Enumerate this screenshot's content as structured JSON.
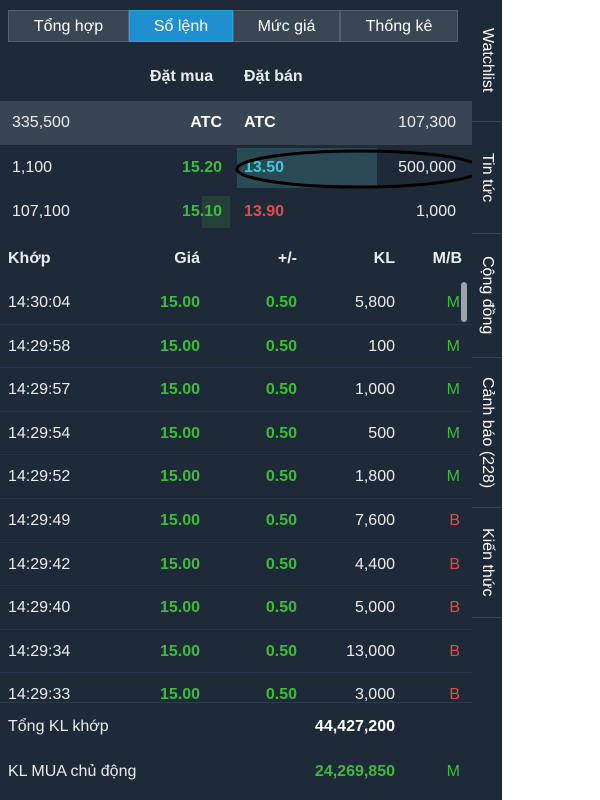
{
  "tabs": [
    {
      "label": "Tổng hợp",
      "active": false
    },
    {
      "label": "Sổ lệnh",
      "active": true
    },
    {
      "label": "Mức giá",
      "active": false
    },
    {
      "label": "Thống kê",
      "active": false
    }
  ],
  "orderbook": {
    "header_buy": "Đặt mua",
    "header_sell": "Đặt bán",
    "rows": [
      {
        "buy_vol": "335,500",
        "buy_price": "ATC",
        "sell_price": "ATC",
        "sell_vol": "107,300"
      },
      {
        "buy_vol": "1,100",
        "buy_price": "15.20",
        "sell_price": "13.50",
        "sell_vol": "500,000"
      },
      {
        "buy_vol": "107,100",
        "buy_price": "15.10",
        "sell_price": "13.90",
        "sell_vol": "1,000"
      }
    ]
  },
  "trades": {
    "headers": {
      "time": "Khớp",
      "price": "Giá",
      "change": "+/-",
      "volume": "KL",
      "side": "M/B"
    },
    "rows": [
      {
        "time": "14:30:04",
        "price": "15.00",
        "change": "0.50",
        "volume": "5,800",
        "side": "M"
      },
      {
        "time": "14:29:58",
        "price": "15.00",
        "change": "0.50",
        "volume": "100",
        "side": "M"
      },
      {
        "time": "14:29:57",
        "price": "15.00",
        "change": "0.50",
        "volume": "1,000",
        "side": "M"
      },
      {
        "time": "14:29:54",
        "price": "15.00",
        "change": "0.50",
        "volume": "500",
        "side": "M"
      },
      {
        "time": "14:29:52",
        "price": "15.00",
        "change": "0.50",
        "volume": "1,800",
        "side": "M"
      },
      {
        "time": "14:29:49",
        "price": "15.00",
        "change": "0.50",
        "volume": "7,600",
        "side": "B"
      },
      {
        "time": "14:29:42",
        "price": "15.00",
        "change": "0.50",
        "volume": "4,400",
        "side": "B"
      },
      {
        "time": "14:29:40",
        "price": "15.00",
        "change": "0.50",
        "volume": "5,000",
        "side": "B"
      },
      {
        "time": "14:29:34",
        "price": "15.00",
        "change": "0.50",
        "volume": "13,000",
        "side": "B"
      },
      {
        "time": "14:29:33",
        "price": "15.00",
        "change": "0.50",
        "volume": "3,000",
        "side": "B"
      }
    ]
  },
  "footer": {
    "total_label": "Tổng KL khớp",
    "total_value": "44,427,200",
    "active_buy_label": "KL MUA chủ động",
    "active_buy_value": "24,269,850",
    "active_buy_side": "M"
  },
  "side_tabs": [
    {
      "label": "Watchlist"
    },
    {
      "label": "Tin tức"
    },
    {
      "label": "Cộng đồng"
    },
    {
      "label": "Cảnh báo (228)"
    },
    {
      "label": "Kiến thức"
    }
  ],
  "colors": {
    "panel_bg": "#1f2a38",
    "active_tab": "#1f8fd0",
    "up_green": "#3cbd3a",
    "down_red": "#e54a4a",
    "highlight_cyan": "#40c9d8"
  }
}
